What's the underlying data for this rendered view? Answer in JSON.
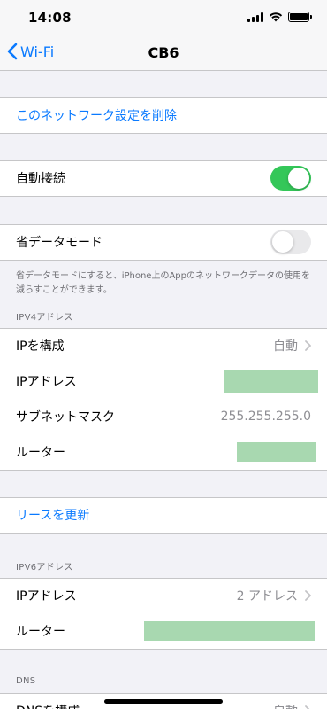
{
  "status": {
    "time": "14:08"
  },
  "nav": {
    "back_label": "Wi-Fi",
    "title": "CB6"
  },
  "forget": {
    "label": "このネットワーク設定を削除"
  },
  "auto_join": {
    "label": "自動接続",
    "on": true
  },
  "low_data": {
    "label": "省データモード",
    "on": false,
    "footer": "省データモードにすると、iPhone上のAppのネットワークデータの使用を減らすことができます。"
  },
  "ipv4": {
    "header": "IPV4アドレス",
    "configure_label": "IPを構成",
    "configure_value": "自動",
    "ip_label": "IPアドレス",
    "subnet_label": "サブネットマスク",
    "subnet_value": "255.255.255.0",
    "router_label": "ルーター"
  },
  "renew": {
    "label": "リースを更新"
  },
  "ipv6": {
    "header": "IPV6アドレス",
    "ip_label": "IPアドレス",
    "ip_value": "2 アドレス",
    "router_label": "ルーター"
  },
  "dns": {
    "header": "DNS",
    "configure_label": "DNSを構成",
    "configure_value": "自動"
  },
  "colors": {
    "accent": "#0a7aff",
    "toggle_on": "#34c759",
    "redaction": "#a8d8b0"
  }
}
